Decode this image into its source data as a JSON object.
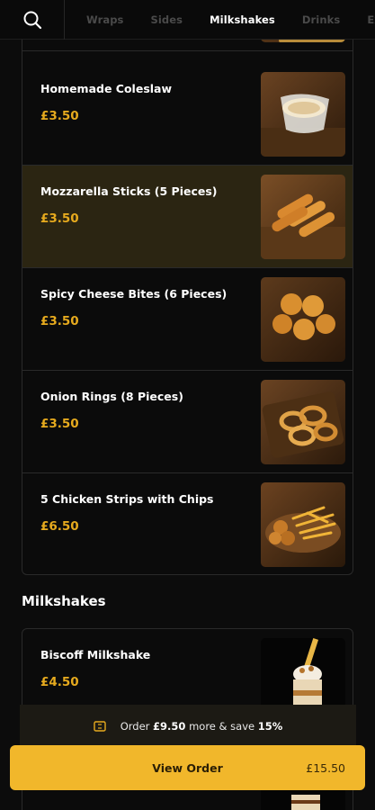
{
  "nav": {
    "search_icon": "search-icon",
    "tabs": [
      "Wraps",
      "Sides",
      "Milkshakes",
      "Drinks",
      "Extras"
    ],
    "active_tab": "Milkshakes"
  },
  "sides": [
    {
      "name": "Homemade Coleslaw",
      "price": "£3.50",
      "image": "coleslaw-image"
    },
    {
      "name": "Mozzarella Sticks (5 Pieces)",
      "price": "£3.50",
      "image": "mozzarella-sticks-image"
    },
    {
      "name": "Spicy Cheese Bites (6 Pieces)",
      "price": "£3.50",
      "image": "cheese-bites-image"
    },
    {
      "name": "Onion Rings (8 Pieces)",
      "price": "£3.50",
      "image": "onion-rings-image"
    },
    {
      "name": "5 Chicken Strips with Chips",
      "price": "£6.50",
      "image": "chicken-strips-image"
    }
  ],
  "milkshakes": {
    "title": "Milkshakes",
    "items": [
      {
        "name": "Biscoff Milkshake",
        "price": "£4.50",
        "image": "biscoff-milkshake-image"
      }
    ]
  },
  "offer": {
    "prefix": "Order",
    "amount": "£9.50",
    "middle": "more & save",
    "discount": "15%",
    "icon": "ticket-icon"
  },
  "order_button": {
    "label": "View Order",
    "total": "£15.50"
  },
  "colors": {
    "accent": "#f1b72b",
    "price": "#e6aa1e",
    "highlight_row": "#2b2512",
    "background": "#0c0c0c"
  }
}
